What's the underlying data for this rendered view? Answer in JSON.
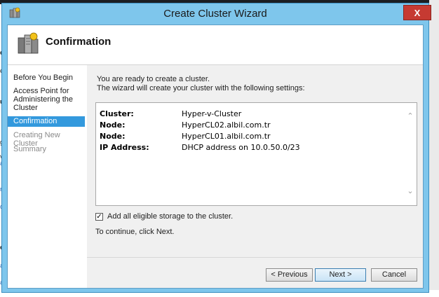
{
  "window": {
    "title": "Create Cluster Wizard",
    "close_label": "X"
  },
  "header": {
    "title": "Confirmation"
  },
  "nav": {
    "items": [
      {
        "label": "Before You Begin",
        "state": "normal"
      },
      {
        "label": "Access Point for Administering the Cluster",
        "state": "normal"
      },
      {
        "label": "Confirmation",
        "state": "active"
      },
      {
        "label": "Creating New Cluster",
        "state": "disabled"
      },
      {
        "label": "Summary",
        "state": "disabled"
      }
    ]
  },
  "main": {
    "intro_line1": "You are ready to create a cluster.",
    "intro_line2": "The wizard will create your cluster with the following settings:",
    "settings": [
      {
        "key": "Cluster:",
        "value": "Hyper-v-Cluster"
      },
      {
        "key": "Node:",
        "value": "HyperCL02.albil.com.tr"
      },
      {
        "key": "Node:",
        "value": "HyperCL01.albil.com.tr"
      },
      {
        "key": "IP Address:",
        "value": "DHCP address on 10.0.50.0/23"
      }
    ],
    "add_storage_checkbox": {
      "label": "Add all eligible storage to the cluster.",
      "checked": true
    },
    "continue_text": "To continue, click Next."
  },
  "buttons": {
    "previous": "< Previous",
    "next": "Next >",
    "cancel": "Cancel"
  },
  "colors": {
    "title_bar": "#7ec6ec",
    "nav_active": "#3399dd",
    "close_button": "#c63a32"
  },
  "background_fragments": [
    "e",
    "ev",
    "us",
    "gi",
    "V",
    "ar",
    "re",
    "o",
    "e",
    "ar",
    "ar"
  ]
}
